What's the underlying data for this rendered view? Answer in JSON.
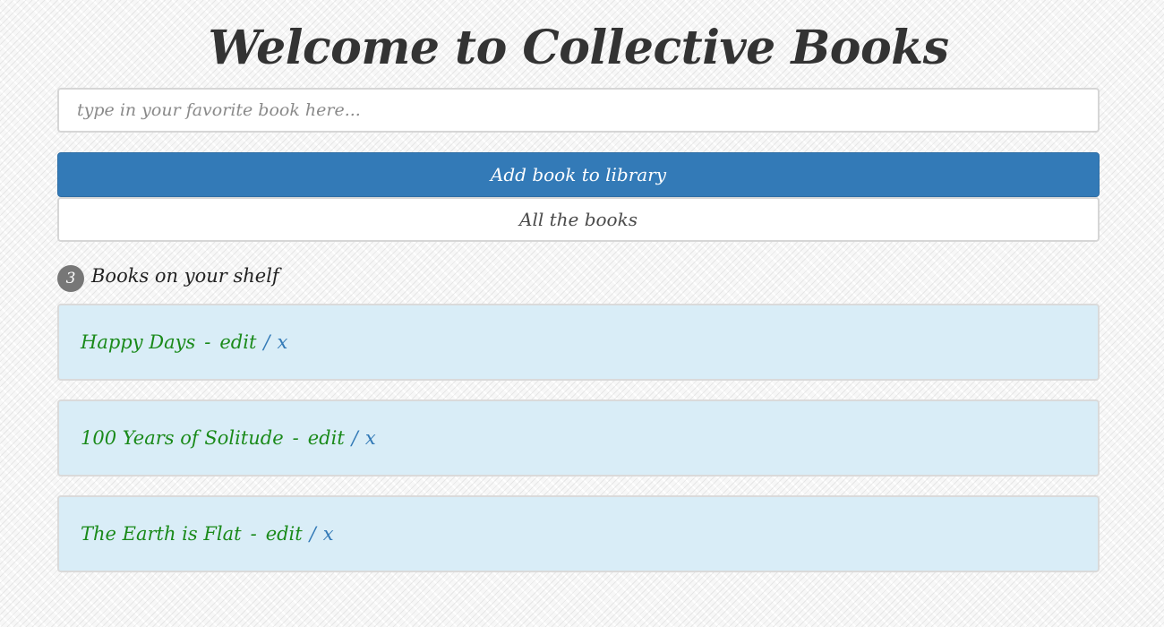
{
  "header": {
    "title": "Welcome to Collective Books"
  },
  "search": {
    "placeholder": "type in your favorite book here..."
  },
  "buttons": {
    "add_label": "Add book to library",
    "all_label": "All the books"
  },
  "shelf": {
    "count": "3",
    "title": "Books on your shelf",
    "books": [
      {
        "title": "Happy Days",
        "separator": "-",
        "edit_label": "edit",
        "slash": "/",
        "delete_label": "x"
      },
      {
        "title": "100 Years of Solitude",
        "separator": "-",
        "edit_label": "edit",
        "slash": "/",
        "delete_label": "x"
      },
      {
        "title": "The Earth is Flat",
        "separator": "-",
        "edit_label": "edit",
        "slash": "/",
        "delete_label": "x"
      }
    ]
  },
  "colors": {
    "primary": "#337ab7",
    "book_row_bg": "#d9edf7",
    "book_title": "#1a8a1a",
    "badge_bg": "#777777"
  }
}
